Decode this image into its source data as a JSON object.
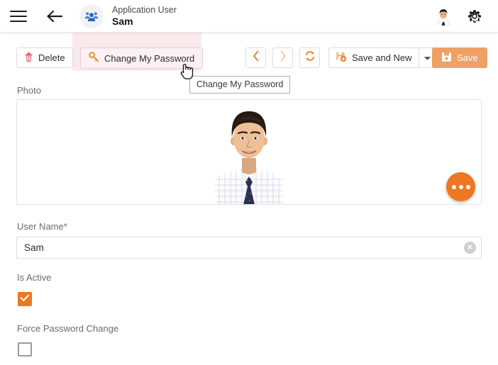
{
  "header": {
    "menu_icon": "hamburger-menu-icon",
    "back_icon": "back-arrow-icon",
    "entity_icon": "users-group-icon",
    "subtitle": "Application User",
    "title": "Sam",
    "avatar_icon": "user-avatar-photo",
    "settings_icon": "gear-icon"
  },
  "toolbar": {
    "delete_label": "Delete",
    "delete_icon": "trash-icon",
    "change_password_label": "Change My Password",
    "change_password_icon": "key-icon",
    "prev_icon": "chevron-left-icon",
    "next_icon": "chevron-right-icon",
    "refresh_icon": "refresh-icon",
    "save_and_new_label": "Save and New",
    "save_and_new_icon": "save-plus-icon",
    "dropdown_icon": "caret-down-icon",
    "save_label": "Save",
    "save_icon": "floppy-disk-icon",
    "highlight_color": "#fae9ec",
    "accent_color": "#ee7722",
    "save_button_color": "#f0a064"
  },
  "tooltip": {
    "text": "Change My Password"
  },
  "form": {
    "photo": {
      "label": "Photo",
      "image_alt": "portrait of man in white checkered shirt and navy tie"
    },
    "fab": {
      "icon": "more-options-icon"
    },
    "username": {
      "label": "User Name*",
      "value": "Sam",
      "placeholder": "",
      "clear_icon": "clear-circle-icon"
    },
    "is_active": {
      "label": "Is Active",
      "checked": true,
      "check_icon": "checkmark-icon"
    },
    "force_password_change": {
      "label": "Force Password Change",
      "checked": false
    }
  }
}
